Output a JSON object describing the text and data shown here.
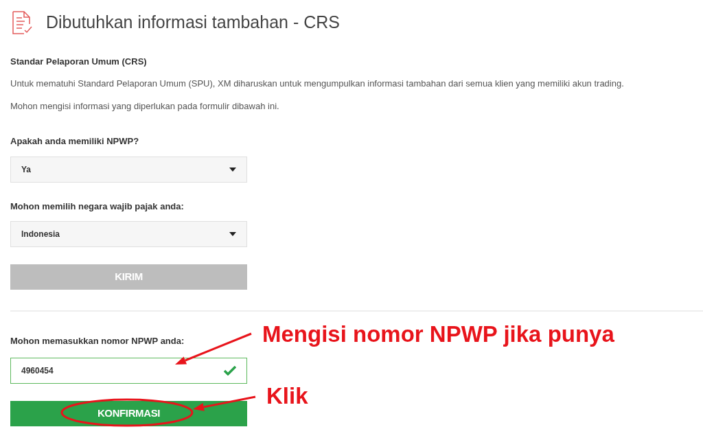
{
  "title": "Dibutuhkan informasi tambahan - CRS",
  "intro": {
    "heading": "Standar Pelaporan Umum (CRS)",
    "paragraphs": [
      "Untuk mematuhi Standard Pelaporan Umum (SPU), XM diharuskan untuk mengumpulkan informasi tambahan dari semua klien yang memiliki akun trading.",
      "Mohon mengisi informasi yang diperlukan pada formulir dibawah ini."
    ]
  },
  "questions": [
    {
      "label": "Apakah anda memiliki NPWP?",
      "value": "Ya"
    },
    {
      "label": "Mohon memilih negara wajib pajak anda:",
      "value": "Indonesia"
    }
  ],
  "submit_button": {
    "label": "KIRIM",
    "disabled": true
  },
  "npwp": {
    "label": "Mohon memasukkan nomor NPWP anda:",
    "value": "4960454",
    "valid": true
  },
  "confirm_button": {
    "label": "KONFIRMASI",
    "disabled": false
  },
  "annotations": [
    {
      "text": "Mengisi nomor NPWP jika punya"
    },
    {
      "text": "Klik"
    }
  ]
}
